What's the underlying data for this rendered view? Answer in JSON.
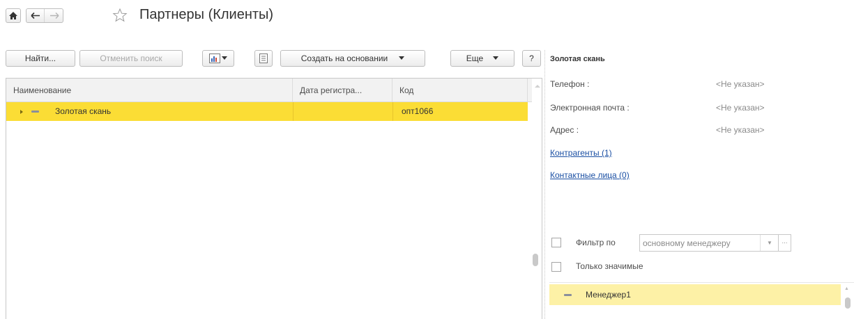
{
  "header": {
    "title": "Партнеры (Клиенты)",
    "home_icon": "home-icon",
    "back_icon": "arrow-left-icon",
    "forward_icon": "arrow-right-icon",
    "favorite_icon": "star-icon"
  },
  "toolbar": {
    "find_label": "Найти...",
    "cancel_search_label": "Отменить поиск",
    "report_icon": "report-icon",
    "dropdown_icon": "chevron-down-icon",
    "list_icon": "list-icon",
    "create_based_label": "Создать на основании",
    "more_label": "Еще",
    "help_label": "?"
  },
  "table": {
    "columns": [
      "Наименование",
      "Дата регистра...",
      "Код"
    ],
    "rows": [
      {
        "name": "Золотая скань",
        "date": "",
        "code": "опт1066"
      }
    ]
  },
  "details": {
    "title": "Золотая скань",
    "phone_label": "Телефон :",
    "phone_value": "<Не указан>",
    "email_label": "Электронная почта :",
    "email_value": "<Не указан>",
    "address_label": "Адрес :",
    "address_value": "<Не указан>",
    "counterparties_link": "Контрагенты (1)",
    "contacts_link": "Контактные лица (0)",
    "filter_label": "Фильтр по",
    "filter_value": "основному менеджеру",
    "filter_more": "...",
    "only_significant_label": "Только значимые",
    "managers": [
      "Менеджер1"
    ]
  },
  "colors": {
    "selected_row": "#fbdd35",
    "manager_row": "#fdf1a6",
    "link": "#1a4fa3"
  }
}
